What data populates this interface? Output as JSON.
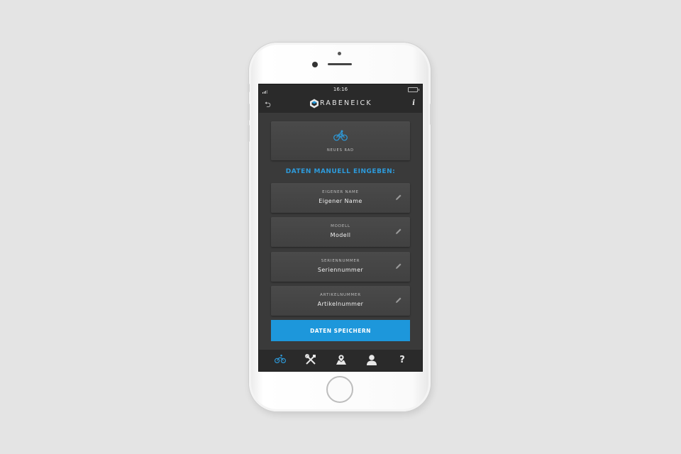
{
  "status_bar": {
    "time": "16:16"
  },
  "nav": {
    "brand": "RABENEICK",
    "back_icon": "back-arrow-icon",
    "info_icon": "info-icon",
    "info_label": "i"
  },
  "bike_card": {
    "icon": "bicycle-icon",
    "label": "NEUES RAD"
  },
  "section_title": "DATEN MANUELL EINGEBEN:",
  "fields": [
    {
      "label": "EIGENER NAME",
      "value": "Eigener Name"
    },
    {
      "label": "MODELL",
      "value": "Modell"
    },
    {
      "label": "SERIENNUMMER",
      "value": "Seriennummer"
    },
    {
      "label": "ARTIKELNUMMER",
      "value": "Artikelnummer"
    }
  ],
  "save_button": "DATEN SPEICHERN",
  "tabs": [
    {
      "icon": "bicycle-icon",
      "active": true
    },
    {
      "icon": "tools-icon",
      "active": false
    },
    {
      "icon": "map-pin-icon",
      "active": false
    },
    {
      "icon": "user-icon",
      "active": false
    },
    {
      "icon": "help-icon",
      "label": "?",
      "active": false
    }
  ],
  "colors": {
    "accent": "#1d97db",
    "background": "#3a3a3a",
    "bar": "#2a2a2a"
  }
}
